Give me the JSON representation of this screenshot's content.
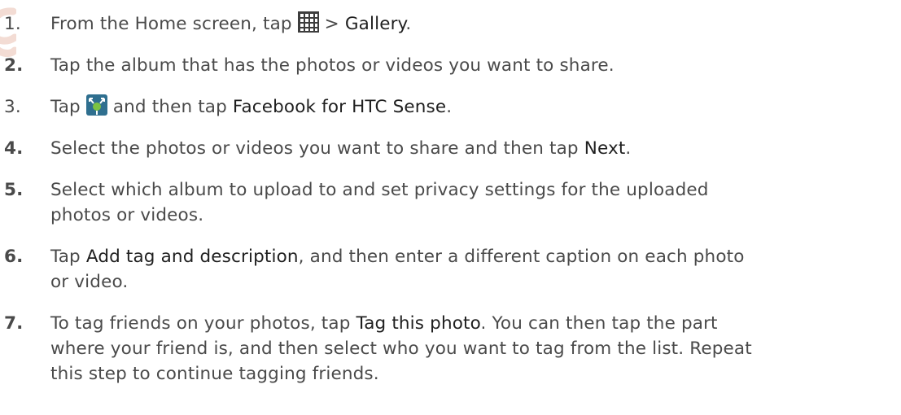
{
  "steps": [
    {
      "number": "1.",
      "parts": [
        "From the Home screen, tap ",
        " > ",
        "Gallery",
        "."
      ],
      "icon": "all-apps-grid-icon"
    },
    {
      "number": "2.",
      "text": "Tap the album that has the photos or videos you want to share."
    },
    {
      "number": "3.",
      "parts": [
        "Tap ",
        " and then tap ",
        "Facebook for HTC Sense",
        "."
      ],
      "icon": "share-icon"
    },
    {
      "number": "4.",
      "parts": [
        "Select the photos or videos you want to share and then tap ",
        "Next",
        "."
      ]
    },
    {
      "number": "5.",
      "lines": [
        "Select which album to upload to and set privacy settings for the uploaded",
        "photos or videos."
      ]
    },
    {
      "number": "6.",
      "parts": [
        "Tap ",
        "Add tag and description",
        ", and then enter a different caption on each photo"
      ],
      "line2": "or video."
    },
    {
      "number": "7.",
      "parts": [
        "To tag friends on your photos, tap ",
        "Tag this photo",
        ". You can then tap the part"
      ],
      "line2": "where your friend is, and then select who you want to tag from the list. Repeat",
      "line3": "this step to continue tagging friends."
    }
  ],
  "colors": {
    "text": "#4a4a4a",
    "highlight": "#1f1f1f",
    "watermark": "#f3dcd4",
    "grid_icon": "#3d3d3d",
    "share_icon_bg": "#2f6f8f"
  }
}
